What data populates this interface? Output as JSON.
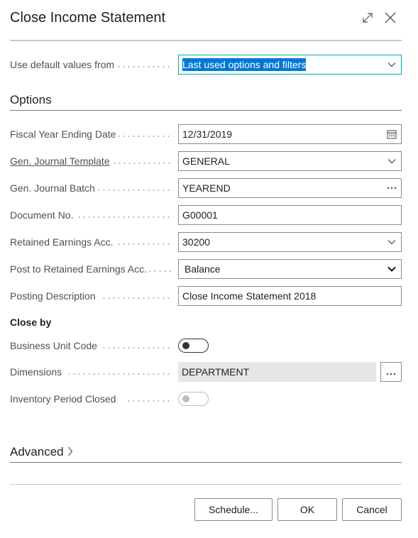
{
  "dialog": {
    "title": "Close Income Statement"
  },
  "defaults": {
    "label": "Use default values from",
    "value": "Last used options and filters"
  },
  "options": {
    "heading": "Options",
    "fiscal_year_ending_date": {
      "label": "Fiscal Year Ending Date",
      "value": "12/31/2019"
    },
    "gen_journal_template": {
      "label": "Gen. Journal Template",
      "value": "GENERAL"
    },
    "gen_journal_batch": {
      "label": "Gen. Journal Batch",
      "value": "YEAREND"
    },
    "document_no": {
      "label": "Document No.",
      "value": "G00001"
    },
    "retained_earnings_acc": {
      "label": "Retained Earnings Acc.",
      "value": "30200"
    },
    "post_to_retained": {
      "label": "Post to Retained Earnings Acc.",
      "value": "Balance"
    },
    "posting_description": {
      "label": "Posting Description",
      "value": "Close Income Statement 2018"
    }
  },
  "close_by": {
    "heading": "Close by",
    "business_unit_code": {
      "label": "Business Unit Code",
      "on": false
    },
    "dimensions": {
      "label": "Dimensions",
      "value": "DEPARTMENT"
    },
    "inventory_period_closed": {
      "label": "Inventory Period Closed",
      "on": false,
      "disabled": true
    }
  },
  "advanced": {
    "heading": "Advanced"
  },
  "buttons": {
    "schedule": "Schedule...",
    "ok": "OK",
    "cancel": "Cancel"
  },
  "icons": {
    "expand": "expand-icon",
    "close": "close-icon",
    "calendar": "calendar-icon",
    "chevron": "chevron-down-icon",
    "ellipsis": "ellipsis-icon",
    "chevron_right": "chevron-right-icon"
  },
  "colors": {
    "selection": "#0078d7",
    "focus_border": "#00a8b0"
  }
}
